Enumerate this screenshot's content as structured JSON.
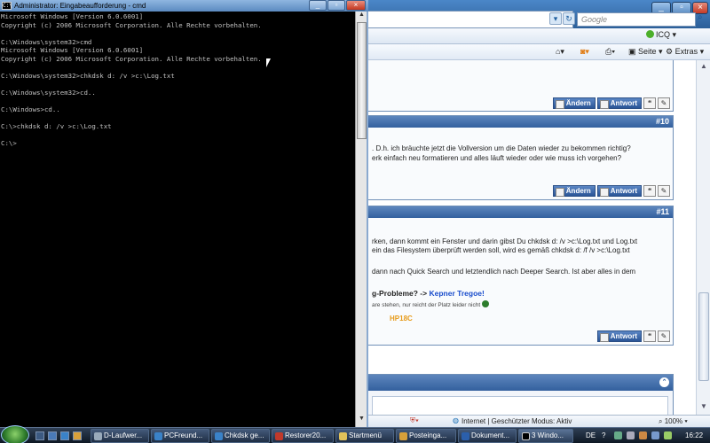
{
  "colors": {
    "console_text": "#c0c0c0",
    "console_bg": "#000000",
    "post_header": "#33609e",
    "link_blue": "#1a4dcc",
    "accent_orange": "#e79b1a"
  },
  "cmd": {
    "title": "Administrator: Eingabeaufforderung - cmd",
    "lines": [
      "Microsoft Windows [Version 6.0.6001]",
      "Copyright (c) 2006 Microsoft Corporation. Alle Rechte vorbehalten.",
      "",
      "C:\\Windows\\system32>cmd",
      "Microsoft Windows [Version 6.0.6001]",
      "Copyright (c) 2006 Microsoft Corporation. Alle Rechte vorbehalten.",
      "",
      "C:\\Windows\\system32>chkdsk d: /v >c:\\Log.txt",
      "",
      "C:\\Windows\\system32>cd..",
      "",
      "C:\\Windows>cd..",
      "",
      "C:\\>chkdsk d: /v >c:\\Log.txt",
      "",
      "C:\\>"
    ]
  },
  "browser": {
    "search_placeholder": "Google",
    "toolbar": {
      "icq": "ICQ",
      "seite": "Seite",
      "extras": "Extras"
    },
    "posts": [
      {
        "number": "#10",
        "lines": [
          ". D.h. ich bräuchte jetzt die Vollversion um die Daten wieder zu bekommen richtig?",
          "erk einfach neu formatieren und alles läuft wieder oder wie muss ich vorgehen?"
        ],
        "buttons": {
          "edit": "Ändern",
          "reply": "Antwort"
        }
      },
      {
        "number": "#11",
        "lines": [
          "rken, dann kommt ein Fenster und darin gibst Du chkdsk d: /v >c:\\Log.txt und Log.txt",
          "ein das Filesystem überprüft werden soll, wird es gemäß chkdsk d: /f /v >c:\\Log.txt",
          "",
          "dann nach Quick Search und letztendlich nach Deeper Search. Ist aber alles in dem"
        ],
        "signature": {
          "prefix": "g-Probleme? ->",
          "link": "Kepner Tregoe!",
          "small": "are stehen, nur reicht der Platz leider nicht",
          "tag": "HP18C"
        },
        "buttons": {
          "reply": "Antwort"
        }
      }
    ],
    "status": {
      "zone": "Internet | Geschützter Modus: Aktiv",
      "zoom": "100%"
    }
  },
  "taskbar": {
    "items": [
      "D-Laufwer...",
      "PCFreund...",
      "Chkdsk ge...",
      "Restorer20...",
      "Startmenü",
      "Posteinga...",
      "Dokument...",
      "3 Windo..."
    ],
    "language": "DE",
    "clock": "16:22"
  }
}
